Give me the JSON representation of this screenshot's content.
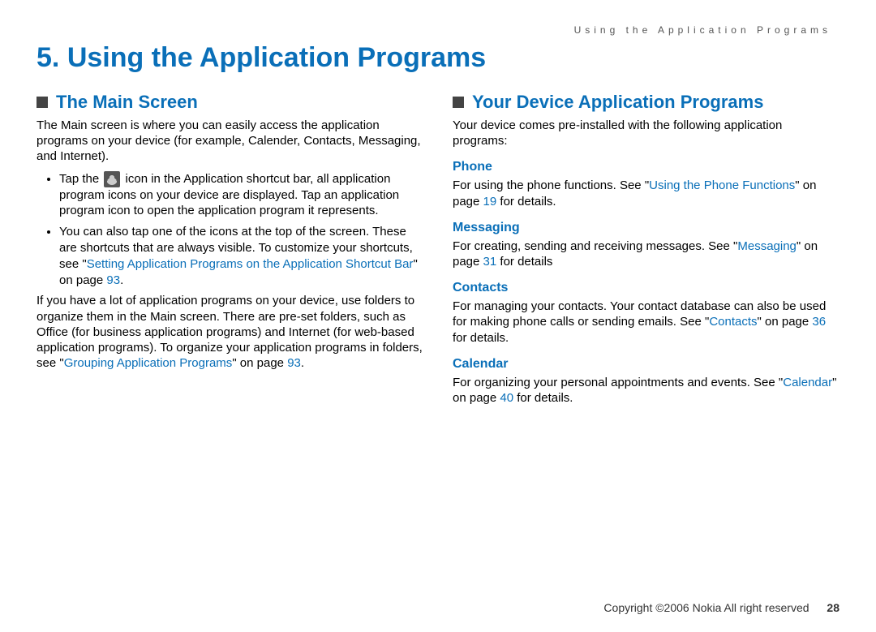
{
  "running_header": "Using the Application Programs",
  "chapter_number": "5.",
  "chapter_title": "Using the Application Programs",
  "left": {
    "section_title": "The Main Screen",
    "intro": "The Main screen is where you can easily access the application programs on your device (for example, Calender, Contacts, Messaging, and Internet).",
    "bullet1_pre": "Tap the ",
    "bullet1_post": " icon in the Application shortcut bar, all application program icons on your device are displayed. Tap an application program icon to open the application program it represents.",
    "bullet2_pre": "You can also tap one of the icons at the top of the screen. These are shortcuts that are always visible. To customize your shortcuts, see \"",
    "bullet2_link": "Setting Application Programs on the Application Shortcut Bar",
    "bullet2_post": "\" on page ",
    "bullet2_page": "93",
    "bullet2_tail": ".",
    "para2_pre": "If you have a lot of application programs on your device, use folders to organize them in the Main screen. There are pre-set folders, such as Office (for business application programs) and Internet (for web-based application programs). To organize your application programs in folders, see \"",
    "para2_link": "Grouping Application Programs",
    "para2_post": "\" on page ",
    "para2_page": "93",
    "para2_tail": "."
  },
  "right": {
    "section_title": "Your Device Application Programs",
    "intro": "Your device comes pre-installed with the following application programs:",
    "items": [
      {
        "title": "Phone",
        "pre": "For using the phone functions. See \"",
        "link": "Using the Phone Functions",
        "mid": "\" on page ",
        "page": "19",
        "post": " for details."
      },
      {
        "title": "Messaging",
        "pre": "For creating, sending and receiving messages. See \"",
        "link": "Messaging",
        "mid": "\" on page ",
        "page": "31",
        "post": " for details"
      },
      {
        "title": "Contacts",
        "pre": "For managing your contacts. Your contact database can also be used for making phone calls or sending emails. See \"",
        "link": "Contacts",
        "mid": "\" on page ",
        "page": "36",
        "post": " for details."
      },
      {
        "title": "Calendar",
        "pre": "For organizing your personal appointments and events. See \"",
        "link": "Calendar",
        "mid": "\" on page ",
        "page": "40",
        "post": " for details."
      }
    ]
  },
  "footer": {
    "text": "Copyright ©2006 Nokia All right reserved",
    "page": "28"
  }
}
